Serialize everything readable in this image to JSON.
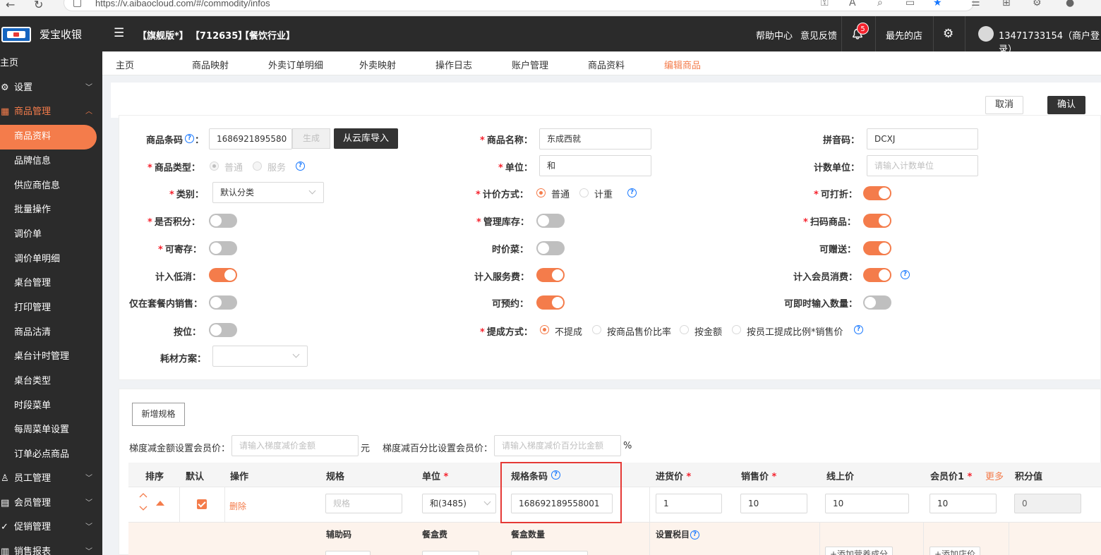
{
  "browser": {
    "url": "https://v.aibaocloud.com/#/commodity/infos"
  },
  "header": {
    "app_name": "爱宝收银",
    "tags": [
      "【旗舰版*】",
      "【712635】",
      "【餐饮行业】"
    ],
    "help": "帮助中心",
    "feedback": "意见反馈",
    "notify_count": "5",
    "store": "最先的店",
    "user": "13471733154（商户登录）"
  },
  "sidebar": {
    "home": "主页",
    "settings": "设置",
    "goods_mgmt": "商品管理",
    "sub_items": [
      "商品资料",
      "品牌信息",
      "供应商信息",
      "批量操作",
      "调价单",
      "调价单明细",
      "桌台管理",
      "打印管理",
      "商品沽清",
      "桌台计时管理",
      "桌台类型",
      "时段菜单",
      "每周菜单设置",
      "订单必点商品"
    ],
    "staff_mgmt": "员工管理",
    "member_mgmt": "会员管理",
    "promo_mgmt": "促销管理",
    "sales_report": "销售报表"
  },
  "tabs": [
    "主页",
    "商品映射",
    "外卖订单明细",
    "外卖映射",
    "操作日志",
    "账户管理",
    "商品资料",
    "编辑商品"
  ],
  "actions": {
    "cancel": "取消",
    "confirm": "确认"
  },
  "form": {
    "barcode_label": "商品条码",
    "barcode_value": "1686921895580",
    "generate": "生成",
    "cloud_import": "从云库导入",
    "name_label": "商品名称",
    "name_value": "东成西就",
    "pinyin_label": "拼音码",
    "pinyin_value": "DCXJ",
    "type_label": "商品类型",
    "type_normal": "普通",
    "type_service": "服务",
    "unit_label": "单位",
    "unit_value": "和",
    "count_unit_label": "计数单位",
    "count_unit_placeholder": "请输入计数单位",
    "category_label": "类别",
    "category_value": "默认分类",
    "pricing_label": "计价方式",
    "pricing_normal": "普通",
    "pricing_weight": "计重",
    "printable_label": "可打折",
    "points_label": "是否积分",
    "stock_label": "管理库存",
    "scan_label": "扫码商品",
    "storable_label": "可寄存",
    "seasonal_label": "时价菜",
    "giftable_label": "可赠送",
    "min_consume_label": "计入低消",
    "service_fee_label": "计入服务费",
    "member_consume_label": "计入会员消费",
    "combo_only_label": "仅在套餐内销售",
    "reservable_label": "可预约",
    "instant_qty_label": "可即时输入数量",
    "by_weight_label": "按位",
    "commission_label": "提成方式",
    "commission_options": [
      "不提成",
      "按商品售价比率",
      "按金额",
      "按员工提成比例*销售价"
    ],
    "material_label": "耗材方案"
  },
  "spec": {
    "add_spec": "新增规格",
    "tier_amount_label": "梯度减金额设置会员价：",
    "tier_amount_placeholder": "请输入梯度减价金额",
    "tier_amount_unit": "元",
    "tier_percent_label": "梯度减百分比设置会员价：",
    "tier_percent_placeholder": "请输入梯度减价百分比金额",
    "tier_percent_unit": "%",
    "columns": [
      "排序",
      "默认",
      "操作",
      "规格",
      "单位",
      "规格条码",
      "进货价",
      "销售价",
      "线上价",
      "会员价1",
      "积分值"
    ],
    "more": "更多",
    "row": {
      "delete": "删除",
      "spec_placeholder": "规格",
      "unit": "和(3485)",
      "barcode": "168692189558001",
      "purchase": "1",
      "sale": "10",
      "online": "10",
      "member": "10",
      "points": "0"
    },
    "sub_columns": [
      "辅助码",
      "餐盒费",
      "餐盒数量",
      "设置税目"
    ],
    "add_nutrition": "+添加营养成分",
    "add_store_price": "+添加店价"
  }
}
